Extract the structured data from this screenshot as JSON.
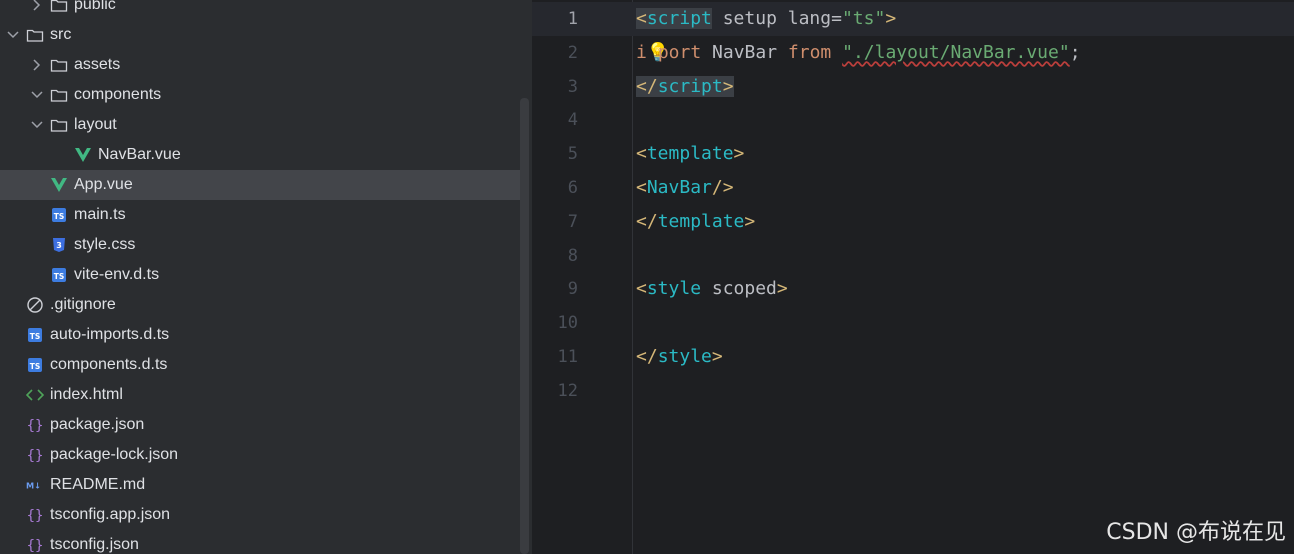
{
  "project_tree": {
    "items": [
      {
        "label": "public",
        "kind": "folder",
        "depth": 1,
        "expanded": false,
        "chevron": "chevron-right"
      },
      {
        "label": "src",
        "kind": "folder",
        "depth": 0,
        "expanded": true,
        "chevron": "chevron-down"
      },
      {
        "label": "assets",
        "kind": "folder",
        "depth": 1,
        "expanded": false,
        "chevron": "chevron-right"
      },
      {
        "label": "components",
        "kind": "folder",
        "depth": 1,
        "expanded": true,
        "chevron": "chevron-down"
      },
      {
        "label": "layout",
        "kind": "folder",
        "depth": 1,
        "expanded": true,
        "chevron": "chevron-down"
      },
      {
        "label": "NavBar.vue",
        "kind": "vue",
        "depth": 2
      },
      {
        "label": "App.vue",
        "kind": "vue",
        "depth": 1,
        "selected": true
      },
      {
        "label": "main.ts",
        "kind": "ts",
        "depth": 1
      },
      {
        "label": "style.css",
        "kind": "css",
        "depth": 1
      },
      {
        "label": "vite-env.d.ts",
        "kind": "ts",
        "depth": 1
      },
      {
        "label": ".gitignore",
        "kind": "ignore",
        "depth": 0
      },
      {
        "label": "auto-imports.d.ts",
        "kind": "ts",
        "depth": 0
      },
      {
        "label": "components.d.ts",
        "kind": "ts",
        "depth": 0
      },
      {
        "label": "index.html",
        "kind": "html",
        "depth": 0
      },
      {
        "label": "package.json",
        "kind": "json",
        "depth": 0
      },
      {
        "label": "package-lock.json",
        "kind": "json",
        "depth": 0
      },
      {
        "label": "README.md",
        "kind": "md",
        "depth": 0
      },
      {
        "label": "tsconfig.app.json",
        "kind": "json",
        "depth": 0
      },
      {
        "label": "tsconfig.json",
        "kind": "json",
        "depth": 0
      }
    ]
  },
  "icons": {
    "vue_color": "#41b883",
    "ts_color": "#3d7ce0",
    "css_color": "#3d6fe0",
    "json_color": "#a97bd6",
    "html_color": "#4fa35a",
    "md_color": "#6b9cf0"
  },
  "editor": {
    "current_line": 1,
    "lines": [
      {
        "num": "1",
        "parts": [
          [
            "tag-bracket hl",
            "<"
          ],
          [
            "tag-name hl",
            "script"
          ],
          [
            "plain",
            " "
          ],
          [
            "attr",
            "setup"
          ],
          [
            "plain",
            " "
          ],
          [
            "attr",
            "lang"
          ],
          [
            "plain",
            "="
          ],
          [
            "str",
            "\"ts\""
          ],
          [
            "tag-bracket",
            ">"
          ]
        ]
      },
      {
        "num": "2",
        "parts": [
          [
            "kw",
            "i"
          ],
          [
            "bulb",
            "💡"
          ],
          [
            "kw",
            "port"
          ],
          [
            "plain",
            " NavBar "
          ],
          [
            "kw",
            "from"
          ],
          [
            "plain",
            " "
          ],
          [
            "str squiggle",
            "\"./layout/NavBar.vue\""
          ],
          [
            "plain",
            ";"
          ]
        ]
      },
      {
        "num": "3",
        "parts": [
          [
            "tag-bracket hl",
            "</"
          ],
          [
            "tag-name hl",
            "script"
          ],
          [
            "tag-bracket hl",
            ">"
          ]
        ]
      },
      {
        "num": "4",
        "parts": []
      },
      {
        "num": "5",
        "parts": [
          [
            "tag-bracket",
            "<"
          ],
          [
            "tag-name",
            "template"
          ],
          [
            "tag-bracket",
            ">"
          ]
        ]
      },
      {
        "num": "6",
        "parts": [
          [
            "tag-bracket",
            "<"
          ],
          [
            "tag-name",
            "NavBar"
          ],
          [
            "tag-bracket",
            "/>"
          ]
        ]
      },
      {
        "num": "7",
        "parts": [
          [
            "tag-bracket",
            "</"
          ],
          [
            "tag-name",
            "template"
          ],
          [
            "tag-bracket",
            ">"
          ]
        ]
      },
      {
        "num": "8",
        "parts": []
      },
      {
        "num": "9",
        "parts": [
          [
            "tag-bracket",
            "<"
          ],
          [
            "tag-name",
            "style"
          ],
          [
            "plain",
            " "
          ],
          [
            "attr",
            "scoped"
          ],
          [
            "tag-bracket",
            ">"
          ]
        ]
      },
      {
        "num": "10",
        "parts": []
      },
      {
        "num": "11",
        "parts": [
          [
            "tag-bracket",
            "</"
          ],
          [
            "tag-name",
            "style"
          ],
          [
            "tag-bracket",
            ">"
          ]
        ]
      },
      {
        "num": "12",
        "parts": []
      }
    ]
  },
  "watermark": "CSDN @布说在见"
}
